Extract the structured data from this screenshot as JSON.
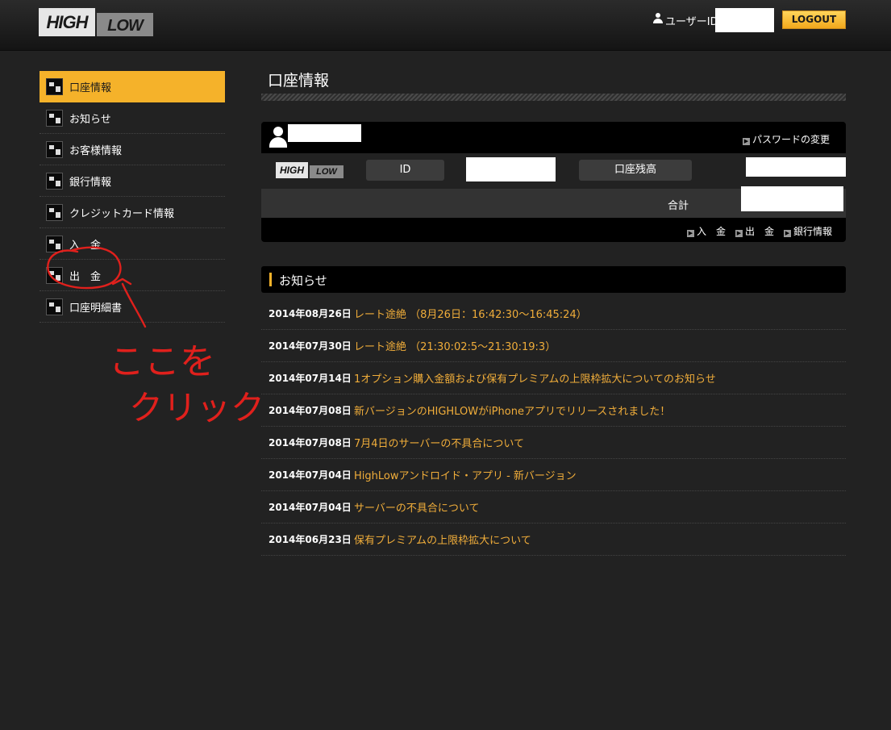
{
  "header": {
    "logo_high": "HIGH",
    "logo_low": "LOW",
    "user_label": "ユーザーID",
    "logout_label": "LOGOUT"
  },
  "sidebar": {
    "items": [
      {
        "label": "口座情報",
        "icon": "account-info-icon",
        "active": true
      },
      {
        "label": "お知らせ",
        "icon": "notice-icon",
        "active": false
      },
      {
        "label": "お客様情報",
        "icon": "customer-info-icon",
        "active": false
      },
      {
        "label": "銀行情報",
        "icon": "bank-info-icon",
        "active": false
      },
      {
        "label": "クレジットカード情報",
        "icon": "credit-card-icon",
        "active": false
      },
      {
        "label": "入　金",
        "icon": "deposit-icon",
        "active": false
      },
      {
        "label": "出　金",
        "icon": "withdrawal-icon",
        "active": false
      },
      {
        "label": "口座明細書",
        "icon": "statement-icon",
        "active": false
      }
    ]
  },
  "main": {
    "title": "口座情報",
    "account_panel": {
      "password_link": "パスワードの変更",
      "id_label": "ID",
      "balance_label": "口座残高",
      "total_label": "合計",
      "links": [
        "入　金",
        "出　金",
        "銀行情報"
      ]
    },
    "news": {
      "title": "お知らせ",
      "items": [
        {
          "date": "2014年08月26日",
          "text": "レート途絶 （8月26日：16:42:30～16:45:24）"
        },
        {
          "date": "2014年07月30日",
          "text": "レート途絶 （21:30:02:5～21:30:19:3）"
        },
        {
          "date": "2014年07月14日",
          "text": "1オプション購入金額および保有プレミアムの上限枠拡大についてのお知らせ"
        },
        {
          "date": "2014年07月08日",
          "text": "新バージョンのHIGHLOWがiPhoneアプリでリリースされました！"
        },
        {
          "date": "2014年07月08日",
          "text": "7月4日のサーバーの不具合について"
        },
        {
          "date": "2014年07月04日",
          "text": "HighLowアンドロイド・アプリ - 新バージョン"
        },
        {
          "date": "2014年07月04日",
          "text": "サーバーの不具合について"
        },
        {
          "date": "2014年06月23日",
          "text": "保有プレミアムの上限枠拡大について"
        }
      ]
    }
  },
  "annotation": {
    "text_line1": "ここを",
    "text_line2": "クリック",
    "color": "#e0201c"
  },
  "colors": {
    "accent": "#f5b22a",
    "news_link": "#f0ad3a",
    "background": "#222222"
  }
}
